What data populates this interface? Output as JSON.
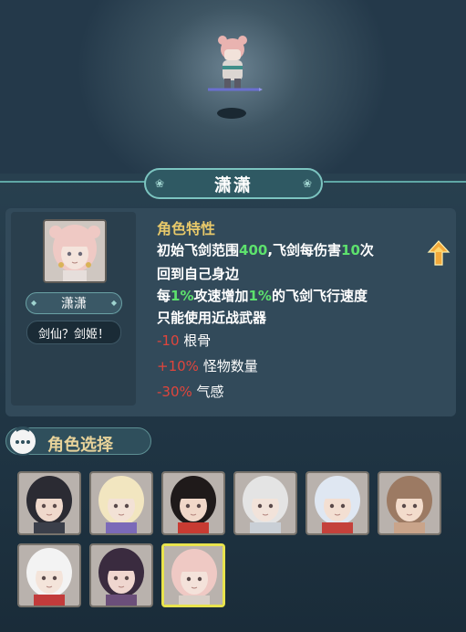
{
  "hero": {
    "name": "潇潇",
    "subtitle": "剑仙？剑姬！"
  },
  "traits": {
    "heading": "角色特性",
    "lines": [
      [
        {
          "t": "初始飞剑范围",
          "hl": false
        },
        {
          "t": "400",
          "hl": true
        },
        {
          "t": ",飞剑每伤害",
          "hl": false
        },
        {
          "t": "10",
          "hl": true
        },
        {
          "t": "次",
          "hl": false
        }
      ],
      [
        {
          "t": "回到自己身边",
          "hl": false
        }
      ],
      [
        {
          "t": "每",
          "hl": false
        },
        {
          "t": "1%",
          "hl": true
        },
        {
          "t": "攻速增加",
          "hl": false
        },
        {
          "t": "1%",
          "hl": true
        },
        {
          "t": "的飞剑飞行速度",
          "hl": false
        }
      ],
      [
        {
          "t": "只能使用近战武器",
          "hl": false
        }
      ]
    ]
  },
  "stats": [
    {
      "value": "-10",
      "label": "根骨"
    },
    {
      "value": "+10%",
      "label": "怪物数量"
    },
    {
      "value": "-30%",
      "label": "气感"
    }
  ],
  "selection": {
    "title": "角色选择",
    "characters": [
      {
        "id": "char-1",
        "hair": "#2b2b33",
        "skin": "#efd9cc",
        "cloth": "#3b3f4a",
        "selected": false
      },
      {
        "id": "char-2",
        "hair": "#f2e6c0",
        "skin": "#f3e2d6",
        "cloth": "#7b6ab8",
        "selected": false
      },
      {
        "id": "char-3",
        "hair": "#1f1a1a",
        "skin": "#f1d8c9",
        "cloth": "#c73b32",
        "selected": false
      },
      {
        "id": "char-4",
        "hair": "#e4e4e4",
        "skin": "#f2e3da",
        "cloth": "#c9cfd6",
        "selected": false
      },
      {
        "id": "char-5",
        "hair": "#dfe7f2",
        "skin": "#f3dfd2",
        "cloth": "#c4413b",
        "selected": false
      },
      {
        "id": "char-6",
        "hair": "#9c7a63",
        "skin": "#f3dccc",
        "cloth": "#c9a48a",
        "selected": false
      },
      {
        "id": "char-7",
        "hair": "#f3f3f3",
        "skin": "#f4e4da",
        "cloth": "#c23b3b",
        "selected": false
      },
      {
        "id": "char-8",
        "hair": "#3a2b3f",
        "skin": "#efd6cf",
        "cloth": "#6b4f7a",
        "selected": false
      },
      {
        "id": "char-9",
        "hair": "#efc9c4",
        "skin": "#f4e2da",
        "cloth": "#d8cfc8",
        "selected": true
      }
    ]
  },
  "colors": {
    "highlight": "#5de16d",
    "negative": "#e0453c",
    "gold": "#e8c96a",
    "selected_border": "#e8e34d"
  }
}
